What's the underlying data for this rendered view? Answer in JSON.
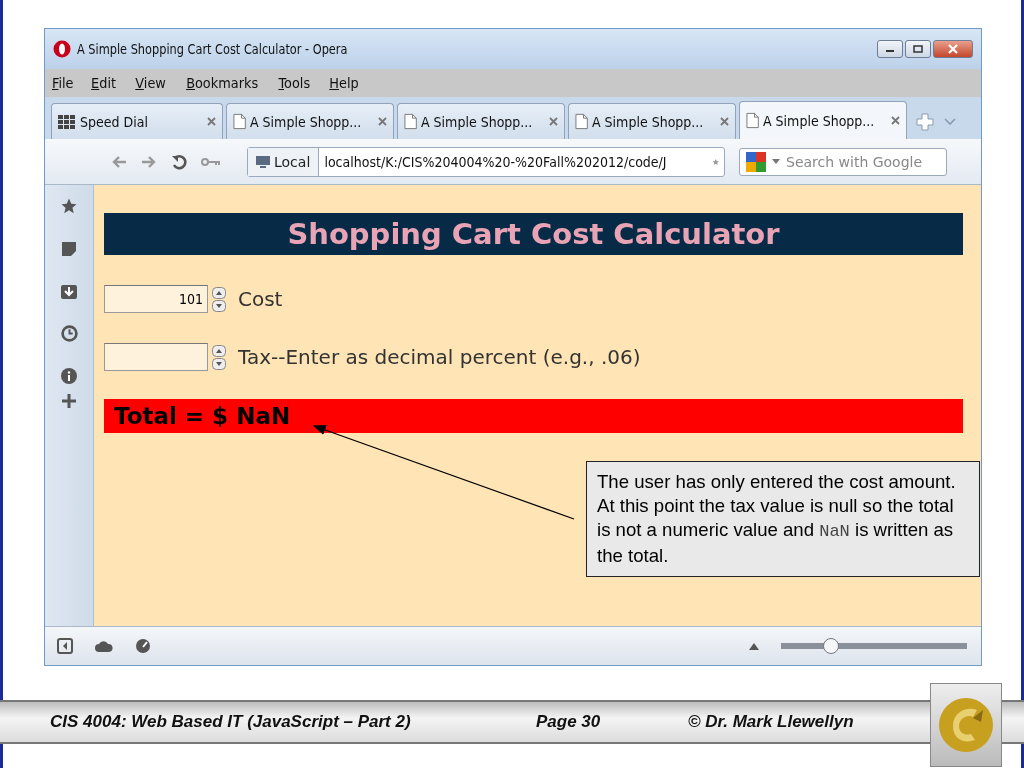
{
  "window": {
    "title": "A Simple Shopping Cart Cost Calculator - Opera"
  },
  "menu": [
    "File",
    "Edit",
    "View",
    "Bookmarks",
    "Tools",
    "Help"
  ],
  "tabs": [
    {
      "label": "Speed Dial",
      "kind": "speed-dial",
      "selected": false
    },
    {
      "label": "A Simple Shopp...",
      "kind": "page",
      "selected": false
    },
    {
      "label": "A Simple Shopp...",
      "kind": "page",
      "selected": false
    },
    {
      "label": "A Simple Shopp...",
      "kind": "page",
      "selected": false
    },
    {
      "label": "A Simple Shopp...",
      "kind": "page",
      "selected": true
    }
  ],
  "address_bar": {
    "badge": "Local",
    "url": "localhost/K:/CIS%204004%20-%20Fall%202012/code/J"
  },
  "search": {
    "placeholder": "Search with Google"
  },
  "page": {
    "heading": "Shopping Cart Cost Calculator",
    "fields": [
      {
        "value": "101",
        "label": "Cost"
      },
      {
        "label": "Tax--Enter as decimal percent (e.g., .06)"
      }
    ],
    "total": "Total = $ NaN"
  },
  "callout": {
    "before": "The user has only entered the cost amount.  At this point the tax value is null so the total is not a numeric value and ",
    "code": "NaN",
    "after": " is written as the total."
  },
  "zoom_slider": {
    "level": 0.27
  },
  "footer": {
    "course": "CIS 4004: Web Based IT (JavaScript – Part 2)",
    "page": "Page 30",
    "author": "© Dr. Mark Llewellyn"
  }
}
